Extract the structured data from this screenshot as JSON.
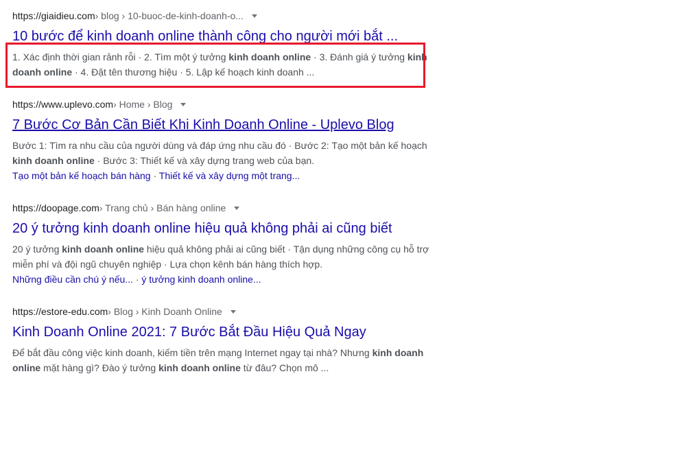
{
  "results": [
    {
      "url": "https://giaidieu.com",
      "path": " › blog › 10-buoc-de-kinh-doanh-o...",
      "title": "10 bước để kinh doanh online thành công cho người mới bắt ...",
      "snippet": [
        {
          "t": "1. Xác định thời gian rảnh rỗi · 2. Tìm một ý tưởng ",
          "b": false
        },
        {
          "t": "kinh doanh online",
          "b": true
        },
        {
          "t": " · 3. Đánh giá ý tưởng ",
          "b": false
        },
        {
          "t": "kinh doanh online",
          "b": true
        },
        {
          "t": " · 4. Đặt tên thương hiệu · 5. Lập kế hoạch kinh doanh ...",
          "b": false
        }
      ]
    },
    {
      "url": "https://www.uplevo.com",
      "path": " › Home › Blog",
      "title": "7 Bước Cơ Bản Cần Biết Khi Kinh Doanh Online - Uplevo Blog",
      "snippet": [
        {
          "t": "Bước 1: Tìm ra nhu cầu của người dùng và đáp ứng nhu cầu đó · Bước 2: Tạo một bản kế hoạch ",
          "b": false
        },
        {
          "t": "kinh doanh online",
          "b": true
        },
        {
          "t": " · Bước 3: Thiết kế và xây dựng trang web của bạn.",
          "b": false
        }
      ],
      "sitelinks": [
        "Tạo một bản kế hoạch bán hàng",
        "Thiết kế và xây dựng một trang..."
      ]
    },
    {
      "url": "https://doopage.com",
      "path": " › Trang chủ › Bán hàng online",
      "title": "20 ý tưởng kinh doanh online hiệu quả không phải ai cũng biết",
      "snippet": [
        {
          "t": "20 ý tưởng ",
          "b": false
        },
        {
          "t": "kinh doanh online",
          "b": true
        },
        {
          "t": " hiệu quả không phải ai cũng biết · Tận dụng những công cụ hỗ trợ miễn phí và đội ngũ chuyên nghiệp · Lựa chọn kênh bán hàng thích hợp.",
          "b": false
        }
      ],
      "sitelinks": [
        "Những điều cần chú ý nếu...",
        "ý tưởng kinh doanh online..."
      ]
    },
    {
      "url": "https://estore-edu.com",
      "path": " › Blog › Kinh Doanh Online",
      "title": "Kinh Doanh Online 2021: 7 Bước Bắt Đầu Hiệu Quả Ngay",
      "snippet": [
        {
          "t": "Để bắt đầu công việc kinh doanh, kiếm tiền trên mạng Internet ngay tại nhà? Nhưng ",
          "b": false
        },
        {
          "t": "kinh doanh online",
          "b": true
        },
        {
          "t": " mặt hàng gì? Đào ý tưởng ",
          "b": false
        },
        {
          "t": "kinh doanh online",
          "b": true
        },
        {
          "t": " từ đâu? Chọn mô ...",
          "b": false
        }
      ]
    }
  ],
  "sitelink_separator": " · ",
  "highlight_color": "#e8182b",
  "link_color": "#1a0dab"
}
